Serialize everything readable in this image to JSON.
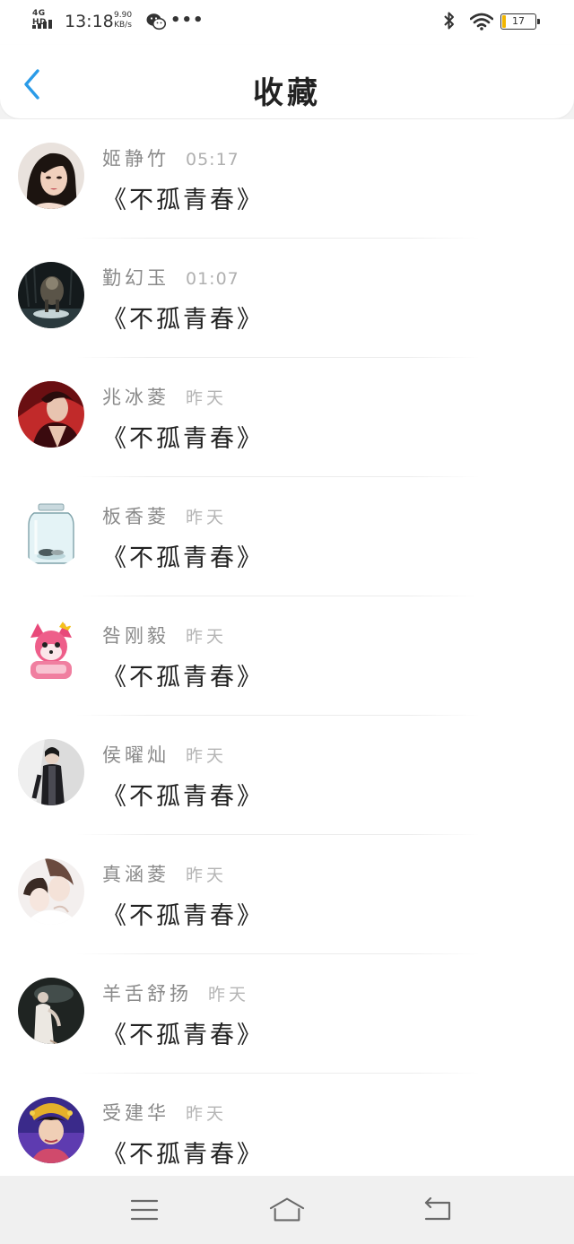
{
  "status_bar": {
    "network": "4G HD",
    "time": "13:18",
    "speed_value": "9.90",
    "speed_unit": "KB/s",
    "battery": "17",
    "battery_level": 0.17,
    "battery_color": "#f2b600"
  },
  "header": {
    "title": "收藏",
    "back_icon": "chevron-left-icon",
    "accent": "#2a9be8"
  },
  "list": {
    "items": [
      {
        "name": "姬静竹",
        "time": "05:17",
        "title": "《不孤青春》",
        "avatar": "avatar-woman-portrait"
      },
      {
        "name": "勤幻玉",
        "time": "01:07",
        "title": "《不孤青春》",
        "avatar": "avatar-dark-creature"
      },
      {
        "name": "兆冰菱",
        "time": "昨天",
        "title": "《不孤青春》",
        "avatar": "avatar-red-character"
      },
      {
        "name": "板香菱",
        "time": "昨天",
        "title": "《不孤青春》",
        "avatar": "avatar-glass-jar"
      },
      {
        "name": "咎刚毅",
        "time": "昨天",
        "title": "《不孤青春》",
        "avatar": "avatar-pink-fox-cartoon"
      },
      {
        "name": "侯曜灿",
        "time": "昨天",
        "title": "《不孤青春》",
        "avatar": "avatar-dark-figure"
      },
      {
        "name": "真涵菱",
        "time": "昨天",
        "title": "《不孤青春》",
        "avatar": "avatar-anime-couple"
      },
      {
        "name": "羊舌舒扬",
        "time": "昨天",
        "title": "《不孤青春》",
        "avatar": "avatar-performer"
      },
      {
        "name": "受建华",
        "time": "昨天",
        "title": "《不孤青春》",
        "avatar": "avatar-costume-character"
      }
    ]
  },
  "bottom_nav": {
    "menu_icon": "menu-icon",
    "home_icon": "home-icon",
    "back_icon": "return-icon"
  }
}
